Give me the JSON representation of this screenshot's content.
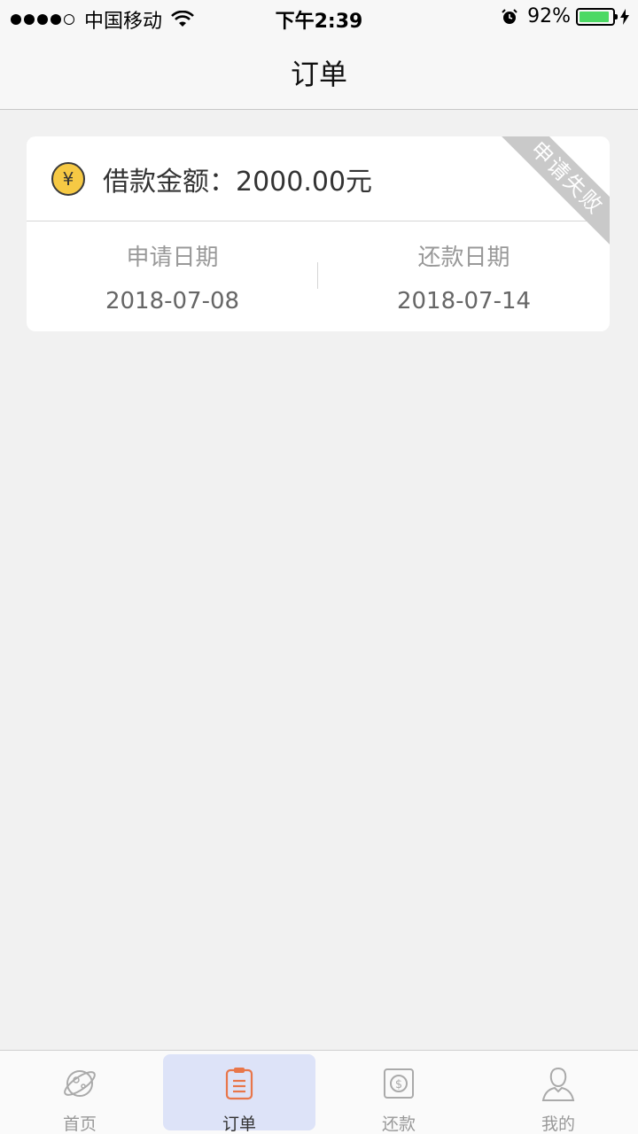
{
  "status_bar": {
    "carrier": "中国移动",
    "time": "下午2:39",
    "battery": "92%",
    "battery_level": 0.92
  },
  "nav": {
    "title": "订单"
  },
  "order": {
    "amount_label": "借款金额：",
    "amount_value": "2000.00元",
    "status": "申请失败",
    "apply_date_label": "申请日期",
    "apply_date": "2018-07-08",
    "repay_date_label": "还款日期",
    "repay_date": "2018-07-14",
    "currency_symbol": "¥"
  },
  "tabs": [
    {
      "label": "首页",
      "icon": "planet-icon"
    },
    {
      "label": "订单",
      "icon": "clipboard-icon",
      "active": true
    },
    {
      "label": "还款",
      "icon": "dollar-icon"
    },
    {
      "label": "我的",
      "icon": "user-icon"
    }
  ],
  "colors": {
    "accent": "#e8764a",
    "active_tab_bg": "#dde3f8",
    "ribbon": "#c9c9c9",
    "coin": "#f6c944"
  }
}
